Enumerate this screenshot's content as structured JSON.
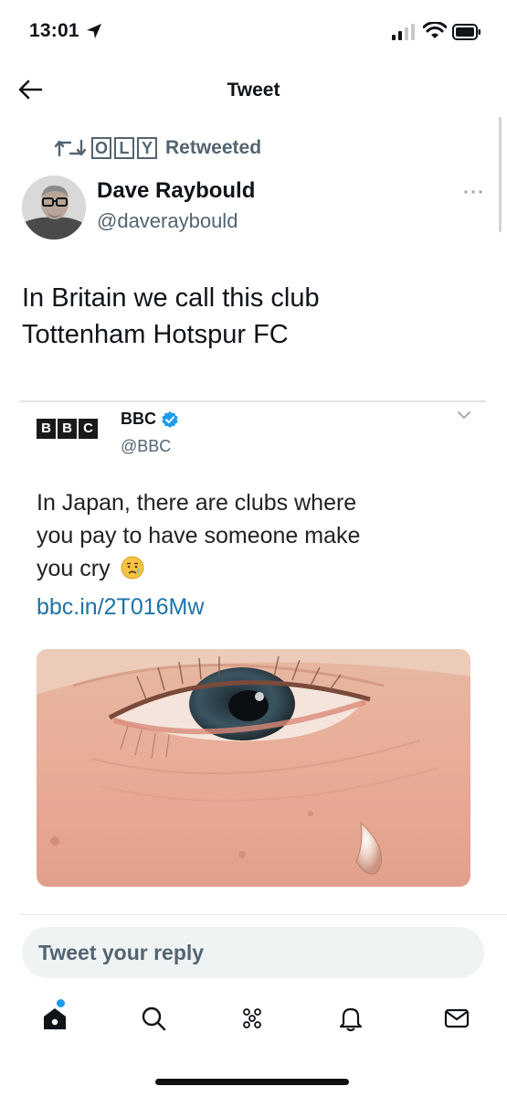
{
  "status_bar": {
    "time": "13:01"
  },
  "nav": {
    "title": "Tweet"
  },
  "retweet": {
    "logo_letters": [
      "O",
      "L",
      "Y"
    ],
    "label": "Retweeted"
  },
  "author": {
    "name": "Dave Raybould",
    "handle": "@daveraybould"
  },
  "tweet": {
    "text_line1": "In Britain we call this club",
    "text_line2": "Tottenham Hotspur FC"
  },
  "embedded": {
    "logo_letters": [
      "B",
      "B",
      "C"
    ],
    "name": "BBC",
    "handle": "@BBC",
    "text_line1": "In Japan, there are clubs where",
    "text_line2": "you pay to have someone make",
    "text_line3": "you cry",
    "link": "bbc.in/2T016Mw"
  },
  "reply": {
    "placeholder": "Tweet your reply"
  },
  "colors": {
    "secondary_text": "#536471",
    "link": "#1d73a8",
    "accent": "#1d9bf0",
    "reply_bg": "#eff3f4"
  },
  "icons": {
    "back": "arrow-left-icon",
    "retweet": "retweet-icon",
    "more": "more-horizontal-icon",
    "verified": "verified-badge-icon",
    "tabs": [
      "home-icon",
      "search-icon",
      "spaces-icon",
      "notifications-icon",
      "messages-icon"
    ]
  }
}
